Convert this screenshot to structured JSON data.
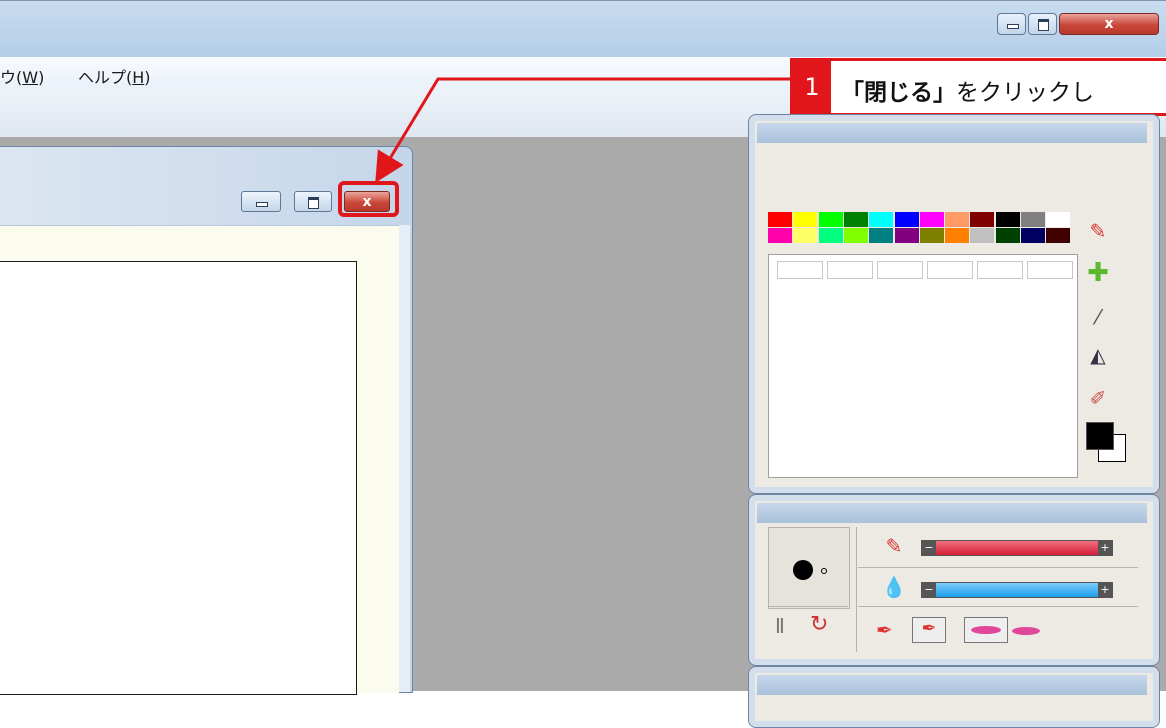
{
  "window": {
    "minimize_glyph": "–",
    "maximize_glyph": "□",
    "close_glyph": "x"
  },
  "menubar": {
    "items": [
      {
        "prefix": "ウ",
        "label": "(W)",
        "letter": "W"
      },
      {
        "label": "ヘルプ",
        "letter": "H"
      }
    ]
  },
  "callout": {
    "step": "1",
    "emphasis": "「閉じる」",
    "text": "をクリックし"
  },
  "palette": {
    "row1": [
      "#ff0000",
      "#ffff00",
      "#00ff00",
      "#008000",
      "#00ffff",
      "#0000ff",
      "#ff00ff",
      "#ff9966",
      "#800000",
      "#000000",
      "#808080",
      "#ffffff"
    ],
    "row2": [
      "#ff00aa",
      "#ffff66",
      "#00ff80",
      "#80ff00",
      "#008080",
      "#800080",
      "#808000",
      "#ff8000",
      "#c0c0c0",
      "#004000",
      "#000060",
      "#400000"
    ]
  },
  "colors": {
    "accent_red": "#e0161b",
    "workspace": "#aaaaaa",
    "paper": "#fbfcee"
  },
  "icons": {
    "pen": "pen-icon",
    "add": "plus-icon",
    "dropper": "eyedropper-icon",
    "bucket": "bucket-icon",
    "brush": "brush-icon"
  }
}
